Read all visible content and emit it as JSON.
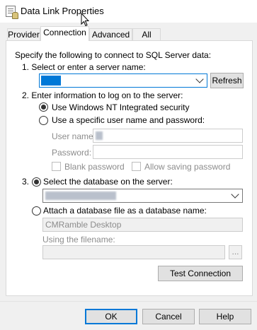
{
  "window": {
    "title": "Data Link Properties"
  },
  "tabs": [
    {
      "label": "Provider"
    },
    {
      "label": "Connection"
    },
    {
      "label": "Advanced"
    },
    {
      "label": "All"
    }
  ],
  "connection": {
    "intro": "Specify the following to connect to SQL Server data:",
    "step1_label": "1. Select or enter a server name:",
    "refresh_label": "Refresh",
    "step2_label": "2. Enter information to log on to the server:",
    "nt_security_label": "Use Windows NT Integrated security",
    "specific_user_label": "Use a specific user name and password:",
    "username_label": "User name:",
    "password_label": "Password:",
    "blank_password_label": "Blank password",
    "allow_saving_label": "Allow saving password",
    "step3_label": "3.",
    "select_db_label": "Select the database on the server:",
    "attach_label": "Attach a database file as a database name:",
    "attach_name_value": "CMRamble Desktop",
    "filename_label": "Using the filename:",
    "browse_label": "...",
    "test_label": "Test Connection"
  },
  "footer": {
    "ok_label": "OK",
    "cancel_label": "Cancel",
    "help_label": "Help"
  },
  "colors": {
    "accent": "#0078d7",
    "disabled_text": "#8c8c8c"
  }
}
